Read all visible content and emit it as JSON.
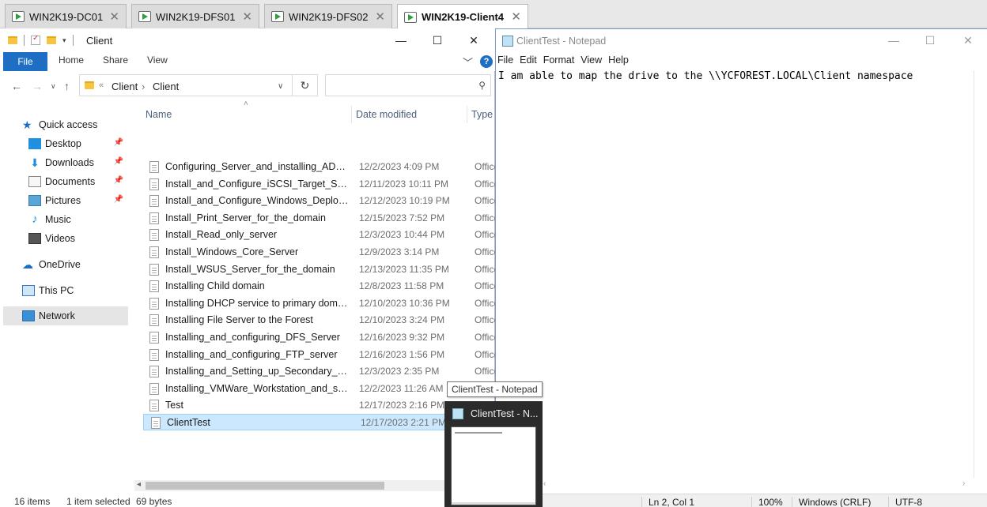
{
  "vm_tabs": [
    {
      "label": "WIN2K19-DC01",
      "active": false
    },
    {
      "label": "WIN2K19-DFS01",
      "active": false
    },
    {
      "label": "WIN2K19-DFS02",
      "active": false
    },
    {
      "label": "WIN2K19-Client4",
      "active": true
    }
  ],
  "explorer": {
    "title": "Client",
    "ribbon_tabs": [
      "File",
      "Home",
      "Share",
      "View"
    ],
    "address": {
      "overflow": "«",
      "crumbs": [
        "Client",
        "Client"
      ]
    },
    "columns": [
      "Name",
      "Date modified",
      "Type"
    ],
    "nav": {
      "quick_access": "Quick access",
      "desktop": "Desktop",
      "downloads": "Downloads",
      "documents": "Documents",
      "pictures": "Pictures",
      "music": "Music",
      "videos": "Videos",
      "onedrive": "OneDrive",
      "this_pc": "This PC",
      "network": "Network"
    },
    "files": [
      {
        "name": "Configuring_Server_and_installing_AD_D...",
        "date": "12/2/2023 4:09 PM",
        "type": "Office"
      },
      {
        "name": "Install_and_Configure_iSCSI_Target_Server",
        "date": "12/11/2023 10:11 PM",
        "type": "Office"
      },
      {
        "name": "Install_and_Configure_Windows_Deploy...",
        "date": "12/12/2023 10:19 PM",
        "type": "Office"
      },
      {
        "name": "Install_Print_Server_for_the_domain",
        "date": "12/15/2023 7:52 PM",
        "type": "Office"
      },
      {
        "name": "Install_Read_only_server",
        "date": "12/3/2023 10:44 PM",
        "type": "Office"
      },
      {
        "name": "Install_Windows_Core_Server",
        "date": "12/9/2023 3:14 PM",
        "type": "Office"
      },
      {
        "name": "Install_WSUS_Server_for_the_domain",
        "date": "12/13/2023 11:35 PM",
        "type": "Office"
      },
      {
        "name": "Installing Child domain",
        "date": "12/8/2023 11:58 PM",
        "type": "Office"
      },
      {
        "name": "Installing DHCP service to primary domai...",
        "date": "12/10/2023 10:36 PM",
        "type": "Office"
      },
      {
        "name": "Installing File Server to the Forest",
        "date": "12/10/2023 3:24 PM",
        "type": "Office"
      },
      {
        "name": "Installing_and_configuring_DFS_Server",
        "date": "12/16/2023 9:32 PM",
        "type": "Office"
      },
      {
        "name": "Installing_and_configuring_FTP_server",
        "date": "12/16/2023 1:56 PM",
        "type": "Office"
      },
      {
        "name": "Installing_and_Setting_up_Secondary_Do...",
        "date": "12/3/2023 2:35 PM",
        "type": "Office"
      },
      {
        "name": "Installing_VMWare_Workstation_and_sett...",
        "date": "12/2/2023 11:26 AM",
        "type": "Office"
      },
      {
        "name": "Test",
        "date": "12/17/2023 2:16 PM",
        "type": "Text I"
      },
      {
        "name": "ClientTest",
        "date": "12/17/2023 2:21 PM",
        "type": ""
      }
    ],
    "status": {
      "items": "16 items",
      "selected": "1 item selected",
      "size": "69 bytes"
    }
  },
  "notepad": {
    "title": "ClientTest - Notepad",
    "menu": [
      "File",
      "Edit",
      "Format",
      "View",
      "Help"
    ],
    "content": "I am able to map the drive to the \\\\YCFOREST.LOCAL\\Client namespace",
    "status": {
      "position": "Ln 2, Col 1",
      "zoom": "100%",
      "line_ending": "Windows (CRLF)",
      "encoding": "UTF-8"
    }
  },
  "tooltip": "ClientTest - Notepad",
  "taskbar_thumbnail": {
    "label": "ClientTest - N..."
  },
  "colors": {
    "accent": "#1e6fc4",
    "selection": "#cce8ff",
    "vm_running": "#2e9e3e"
  }
}
